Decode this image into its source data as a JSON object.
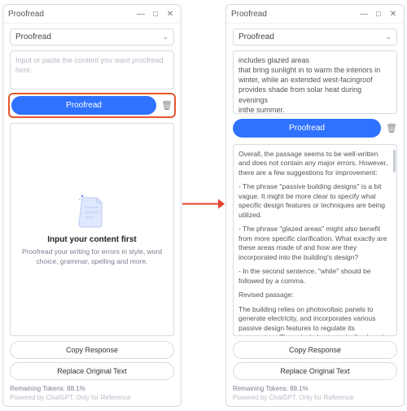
{
  "window": {
    "title": "Proofread"
  },
  "mode": {
    "selected": "Proofread"
  },
  "left": {
    "placeholder": "Input or paste the content you want proofread here.",
    "empty_title": "Input your content first",
    "empty_sub": "Proofread your writing for errors in style, word choice, grammar, spelling and more."
  },
  "right": {
    "input_text": "includes glazed areas\nthat bring sunlight in to warm the interiors in winter, while an extended west-facingroof provides shade from solar heat during evenings\ninthe summer.",
    "result_p1": "Overall, the passage seems to be well-written and does not contain any major errors. However, there are a few suggestions for improvement:",
    "result_b1": "- The phrase \"passive building designs\" is a bit vague. It might be more clear to specify what specific design features or techniques are being utilized.",
    "result_b2": "- The phrase \"glazed areas\" might also benefit from more specific clarification. What exactly are these areas made of and how are they incorporated into the building's design?",
    "result_b3": "- In the second sentence, \"while\" should be followed by a comma.",
    "result_rev_h": "Revised passage:",
    "result_rev": "The building relies on photovoltaic panels to generate electricity, and incorporates various passive design features to regulate its temperature. These include strategically placed glazing to admit sunlight and warm"
  },
  "buttons": {
    "proofread": "Proofread",
    "copy": "Copy Response",
    "replace": "Replace Original Text"
  },
  "footer": {
    "tokens": "Remaining Tokens: 88.1%",
    "powered": "Powered by ChatGPT. Only for Reference"
  }
}
